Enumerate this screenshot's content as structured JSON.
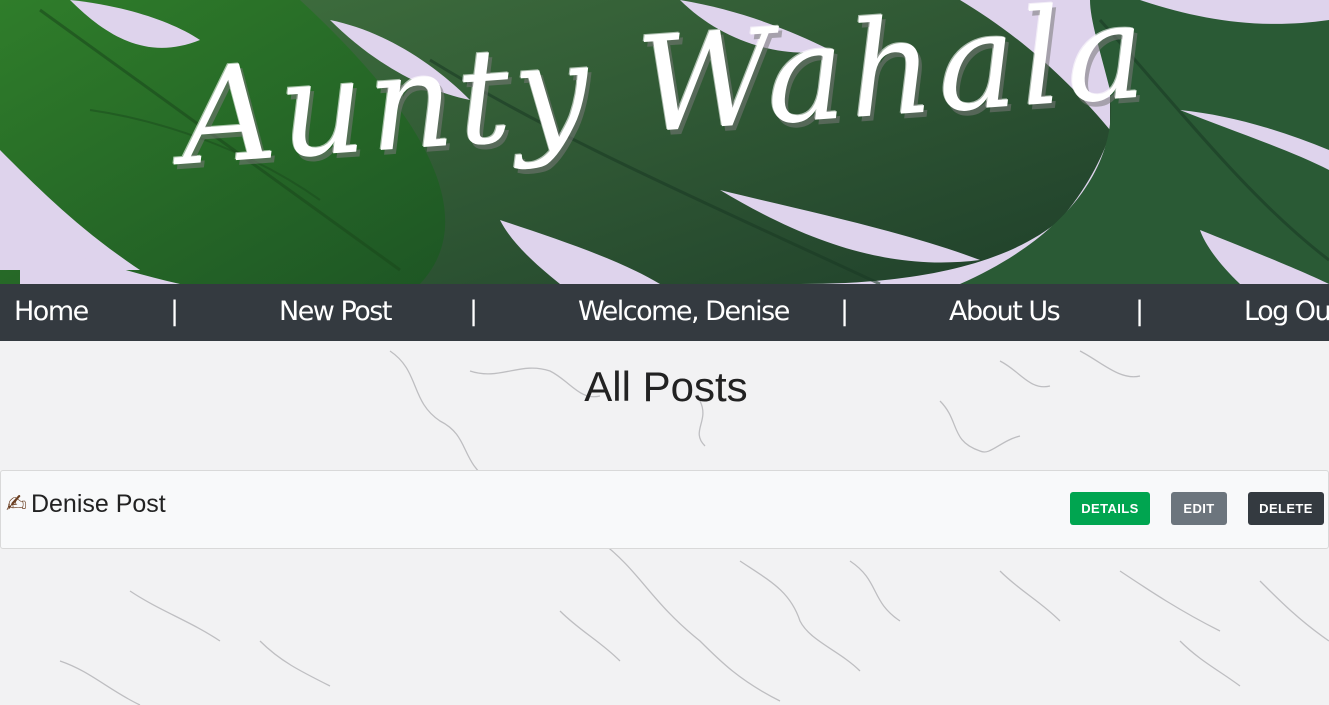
{
  "header": {
    "brand": "Aunty Wahala"
  },
  "nav": {
    "home": "Home",
    "new_post": "New Post",
    "welcome": "Welcome, Denise",
    "about": "About Us",
    "logout": "Log Out",
    "separator": "|"
  },
  "main": {
    "title": "All Posts",
    "posts": [
      {
        "emoji": "✍",
        "title": "Denise Post",
        "details_label": "DETAILS",
        "edit_label": "EDIT",
        "delete_label": "DELETE"
      }
    ]
  },
  "colors": {
    "nav_bg": "#343a40",
    "details": "#00a550",
    "edit": "#6c757d",
    "delete": "#343a40",
    "banner_bg": "#ded3ec"
  }
}
